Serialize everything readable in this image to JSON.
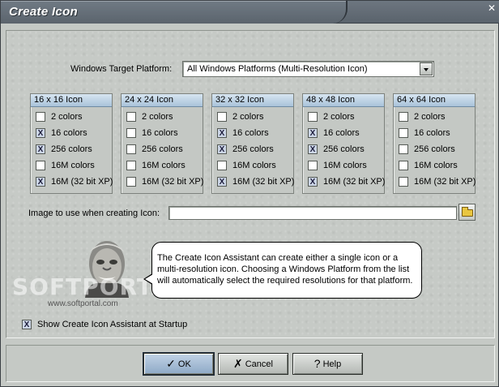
{
  "window": {
    "title": "Create Icon",
    "close_glyph": "✕"
  },
  "platform": {
    "label": "Windows Target Platform:",
    "selected": "All Windows Platforms (Multi-Resolution Icon)"
  },
  "icon_groups": [
    {
      "header": "16 x 16 Icon",
      "options": [
        {
          "label": "2 colors",
          "mark": ""
        },
        {
          "label": "16 colors",
          "mark": "X"
        },
        {
          "label": "256 colors",
          "mark": "X"
        },
        {
          "label": "16M colors",
          "mark": ""
        },
        {
          "label": "16M (32 bit XP)",
          "mark": "X"
        }
      ]
    },
    {
      "header": "24 x 24 Icon",
      "options": [
        {
          "label": "2 colors",
          "mark": ""
        },
        {
          "label": "16 colors",
          "mark": ""
        },
        {
          "label": "256 colors",
          "mark": ""
        },
        {
          "label": "16M colors",
          "mark": ""
        },
        {
          "label": "16M (32 bit XP)",
          "mark": ""
        }
      ]
    },
    {
      "header": "32 x 32 Icon",
      "options": [
        {
          "label": "2 colors",
          "mark": ""
        },
        {
          "label": "16 colors",
          "mark": "X"
        },
        {
          "label": "256 colors",
          "mark": "X"
        },
        {
          "label": "16M colors",
          "mark": ""
        },
        {
          "label": "16M (32 bit XP)",
          "mark": "X"
        }
      ]
    },
    {
      "header": "48 x 48 Icon",
      "options": [
        {
          "label": "2 colors",
          "mark": ""
        },
        {
          "label": "16 colors",
          "mark": "X"
        },
        {
          "label": "256 colors",
          "mark": "X"
        },
        {
          "label": "16M colors",
          "mark": ""
        },
        {
          "label": "16M (32 bit XP)",
          "mark": "X"
        }
      ]
    },
    {
      "header": "64 x 64 Icon",
      "options": [
        {
          "label": "2 colors",
          "mark": ""
        },
        {
          "label": "16 colors",
          "mark": ""
        },
        {
          "label": "256 colors",
          "mark": ""
        },
        {
          "label": "16M colors",
          "mark": ""
        },
        {
          "label": "16M (32 bit XP)",
          "mark": ""
        }
      ]
    }
  ],
  "image": {
    "label": "Image to use when creating Icon:",
    "value": "",
    "browse_icon": "folder-icon"
  },
  "assistant": {
    "lines": [
      "The Create Icon Assistant can create either a single icon or a",
      "multi-resolution icon. Choosing a Windows Platform from the list",
      "will automatically select the required resolutions for that platform."
    ]
  },
  "watermark": {
    "text": "SOFTPORTAL",
    "url": "www.softportal.com"
  },
  "startup": {
    "label": "Show Create Icon Assistant at Startup",
    "mark": "X"
  },
  "buttons": {
    "ok": {
      "label": "OK",
      "glyph": "✓"
    },
    "cancel": {
      "label": "Cancel",
      "glyph": "✗"
    },
    "help": {
      "label": "Help",
      "glyph": "?"
    }
  },
  "colors": {
    "accent": "#a9c3da",
    "default_button": "#8ea9c6",
    "titlebar": "#5a636c"
  }
}
